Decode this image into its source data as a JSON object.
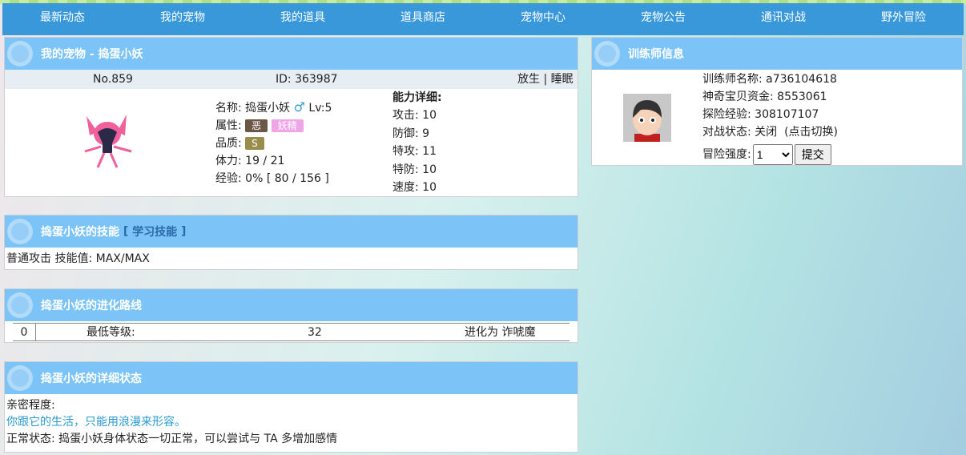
{
  "nav": [
    "最新动态",
    "我的宠物",
    "我的道具",
    "道具商店",
    "宠物中心",
    "宠物公告",
    "通讯对战",
    "野外冒险"
  ],
  "pet": {
    "title": "我的宠物 - 捣蛋小妖",
    "no": "No.859",
    "id": "ID: 363987",
    "release": "放生",
    "sep": "|",
    "sleep": "睡眠",
    "name_label": "名称:",
    "name": "捣蛋小妖",
    "gender": "♂",
    "level": "Lv:5",
    "attr_label": "属性:",
    "types": [
      "恶",
      "妖精"
    ],
    "quality_label": "品质:",
    "quality": "S",
    "hp": "体力: 19 / 21",
    "exp": "经验: 0% [ 80 / 156 ]",
    "ability_title": "能力详细:",
    "stats": [
      "攻击: 10",
      "防御: 9",
      "特攻: 11",
      "特防: 10",
      "速度: 10"
    ]
  },
  "skills": {
    "title": "捣蛋小妖的技能",
    "learn_open": "[",
    "learn": "学习技能",
    "learn_close": "]",
    "items": [
      "普通攻击 技能值: MAX/MAX"
    ]
  },
  "evolution": {
    "title": "捣蛋小妖的进化路线",
    "index": "0",
    "label": "最低等级:",
    "level": "32",
    "to": "进化为 诈唬魔"
  },
  "status": {
    "title": "捣蛋小妖的详细状态",
    "intimacy_label": "亲密程度:",
    "intimacy": "你跟它的生活，只能用浪漫来形容。",
    "health": "正常状态: 捣蛋小妖身体状态一切正常，可以尝试与 TA 多增加感情"
  },
  "trainer": {
    "title": "训练师信息",
    "name": "训练师名称: a736104618",
    "money": "神奇宝贝资金: 8553061",
    "exp": "探险经验: 308107107",
    "battle_label": "对战状态:",
    "battle": "关闭",
    "toggle": "(点击切换)",
    "difficulty_label": "冒险强度:",
    "difficulty": "1",
    "submit": "提交"
  }
}
